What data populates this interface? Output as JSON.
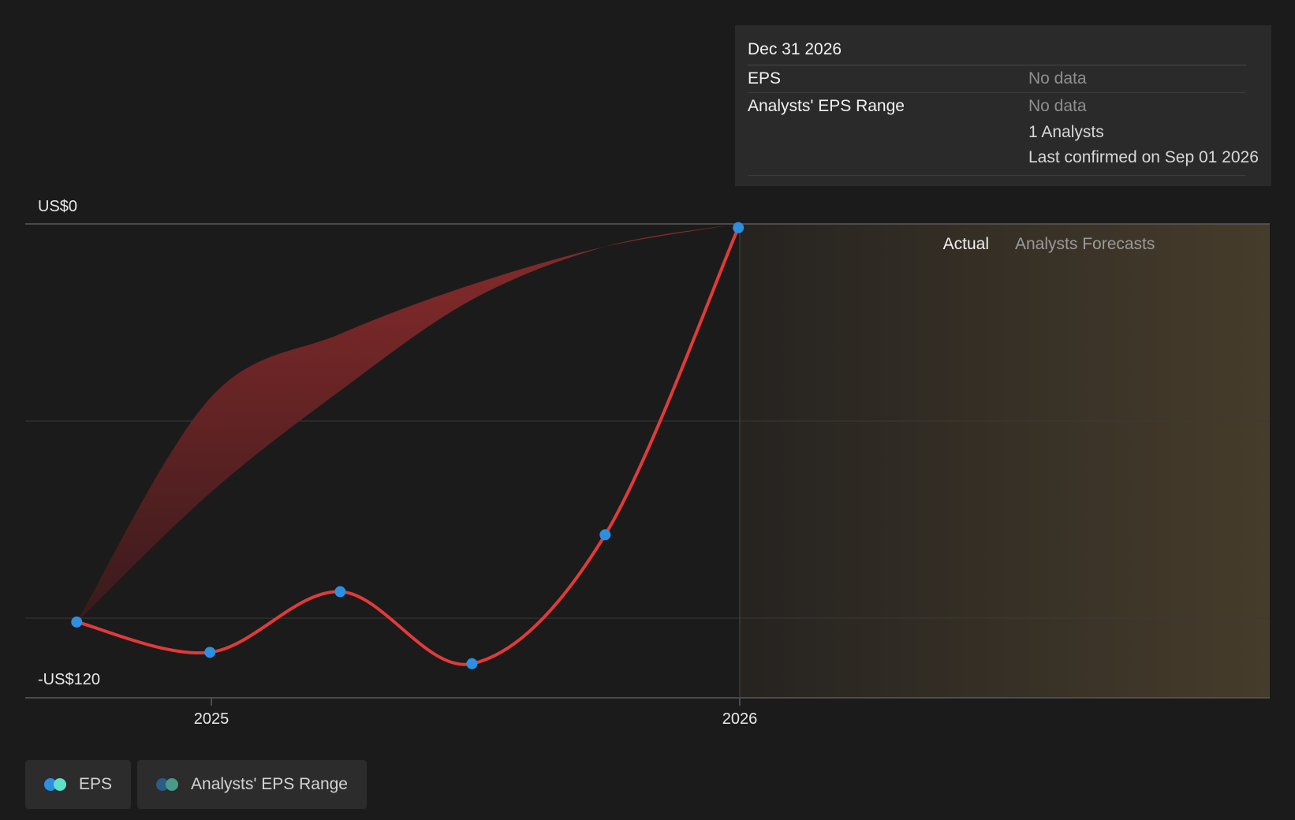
{
  "chart_data": {
    "type": "line",
    "x_ticks": [
      "2025",
      "2026"
    ],
    "y_labels": {
      "top": "US$0",
      "bottom": "-US$120"
    },
    "ylim": [
      -120,
      0
    ],
    "grid": true,
    "series": [
      {
        "name": "EPS",
        "color": "#e23a3a",
        "marker_color": "#2d8fe0",
        "points": [
          {
            "x": "2024-09-30",
            "y": -105
          },
          {
            "x": "2024-12-31",
            "y": -113
          },
          {
            "x": "2025-03-31",
            "y": -97
          },
          {
            "x": "2025-06-30",
            "y": -116
          },
          {
            "x": "2025-09-30",
            "y": -82
          },
          {
            "x": "2025-12-31",
            "y": -1
          }
        ]
      },
      {
        "name": "Analysts' EPS Range",
        "color": "#8b2b2b",
        "upper": [
          {
            "x": "2024-09-30",
            "y": -105
          },
          {
            "x": "2024-12-31",
            "y": -46
          },
          {
            "x": "2025-03-31",
            "y": -29
          },
          {
            "x": "2025-06-30",
            "y": -16
          },
          {
            "x": "2025-09-30",
            "y": -6
          },
          {
            "x": "2025-12-31",
            "y": 0
          }
        ],
        "lower": [
          {
            "x": "2024-09-30",
            "y": -105
          },
          {
            "x": "2024-12-31",
            "y": -71
          },
          {
            "x": "2025-03-31",
            "y": -44
          },
          {
            "x": "2025-06-30",
            "y": -20
          },
          {
            "x": "2025-09-30",
            "y": -6
          },
          {
            "x": "2025-12-31",
            "y": 0
          }
        ]
      }
    ],
    "regions": {
      "actual_label": "Actual",
      "forecast_label": "Analysts Forecasts"
    }
  },
  "tooltip": {
    "date": "Dec 31 2026",
    "rows": [
      {
        "label": "EPS",
        "value": "No data"
      },
      {
        "label": "Analysts' EPS Range",
        "value": "No data"
      }
    ],
    "analysts": "1 Analysts",
    "confirmed": "Last confirmed on Sep 01 2026"
  },
  "legend": [
    {
      "label": "EPS",
      "colors": [
        "#2d8fe0",
        "#5fe0c8"
      ]
    },
    {
      "label": "Analysts' EPS Range",
      "colors": [
        "#2a5c86",
        "#4a9a8a"
      ]
    }
  ],
  "colors": {
    "background": "#1b1b1b",
    "grid": "#3a3a3a",
    "forecast_start": "#262320",
    "forecast_end": "#463c2b"
  }
}
